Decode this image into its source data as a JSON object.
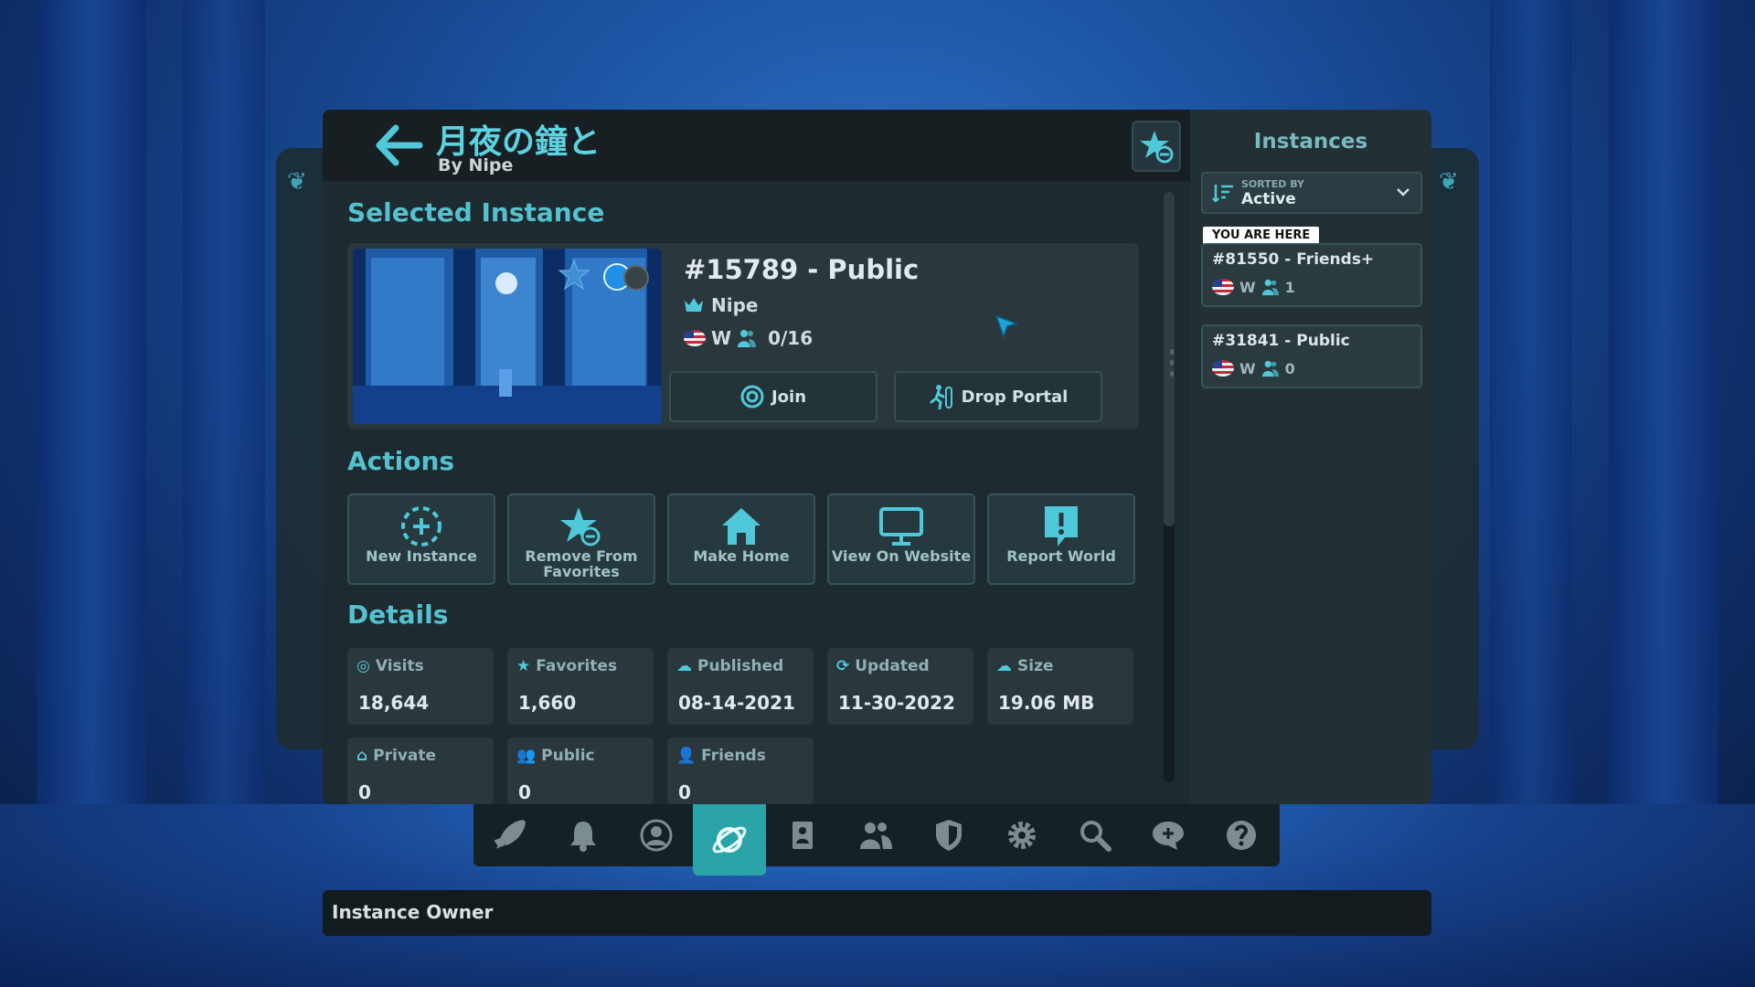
{
  "world": {
    "title": "月夜の鐘と",
    "author": "By Nipe"
  },
  "selected_instance": {
    "section_title": "Selected Instance",
    "name": "#15789 - Public",
    "owner": "Nipe",
    "region": "W",
    "players": "0/16",
    "join_label": "Join",
    "drop_portal_label": "Drop Portal"
  },
  "actions": {
    "section_title": "Actions",
    "items": [
      {
        "label": "New Instance",
        "icon": "dashed-plus-icon"
      },
      {
        "label": "Remove From Favorites",
        "icon": "star-minus-icon"
      },
      {
        "label": "Make Home",
        "icon": "home-icon"
      },
      {
        "label": "View On Website",
        "icon": "monitor-icon"
      },
      {
        "label": "Report World",
        "icon": "exclamation-icon"
      }
    ]
  },
  "details": {
    "section_title": "Details",
    "items": [
      {
        "key": "Visits",
        "value": "18,644",
        "icon": "visits-icon"
      },
      {
        "key": "Favorites",
        "value": "1,660",
        "icon": "star-icon"
      },
      {
        "key": "Published",
        "value": "08-14-2021",
        "icon": "cloud-upload-icon"
      },
      {
        "key": "Updated",
        "value": "11-30-2022",
        "icon": "refresh-icon"
      },
      {
        "key": "Size",
        "value": "19.06 MB",
        "icon": "cloud-download-icon"
      },
      {
        "key": "Private",
        "value": "0",
        "icon": "house-lock-icon"
      },
      {
        "key": "Public",
        "value": "0",
        "icon": "group-icon"
      },
      {
        "key": "Friends",
        "value": "0",
        "icon": "friends-icon"
      }
    ]
  },
  "instances_panel": {
    "title": "Instances",
    "sort_caption": "SORTED BY",
    "sort_value": "Active",
    "you_are_here": "YOU ARE HERE",
    "items": [
      {
        "name": "#81550 - Friends+",
        "region": "W",
        "count": "1"
      },
      {
        "name": "#31841 - Public",
        "region": "W",
        "count": "0"
      }
    ]
  },
  "nav": {
    "items": [
      "rocket-icon",
      "bell-icon",
      "profile-icon",
      "worlds-icon",
      "avatars-icon",
      "social-icon",
      "safety-icon",
      "settings-icon",
      "search-icon",
      "chat-icon",
      "help-icon"
    ],
    "active_index": 3
  },
  "tooltip": "Instance Owner",
  "colors": {
    "accent": "#5dd2e0",
    "panel": "#1d2a2f",
    "active_nav": "#2aa3a9"
  }
}
